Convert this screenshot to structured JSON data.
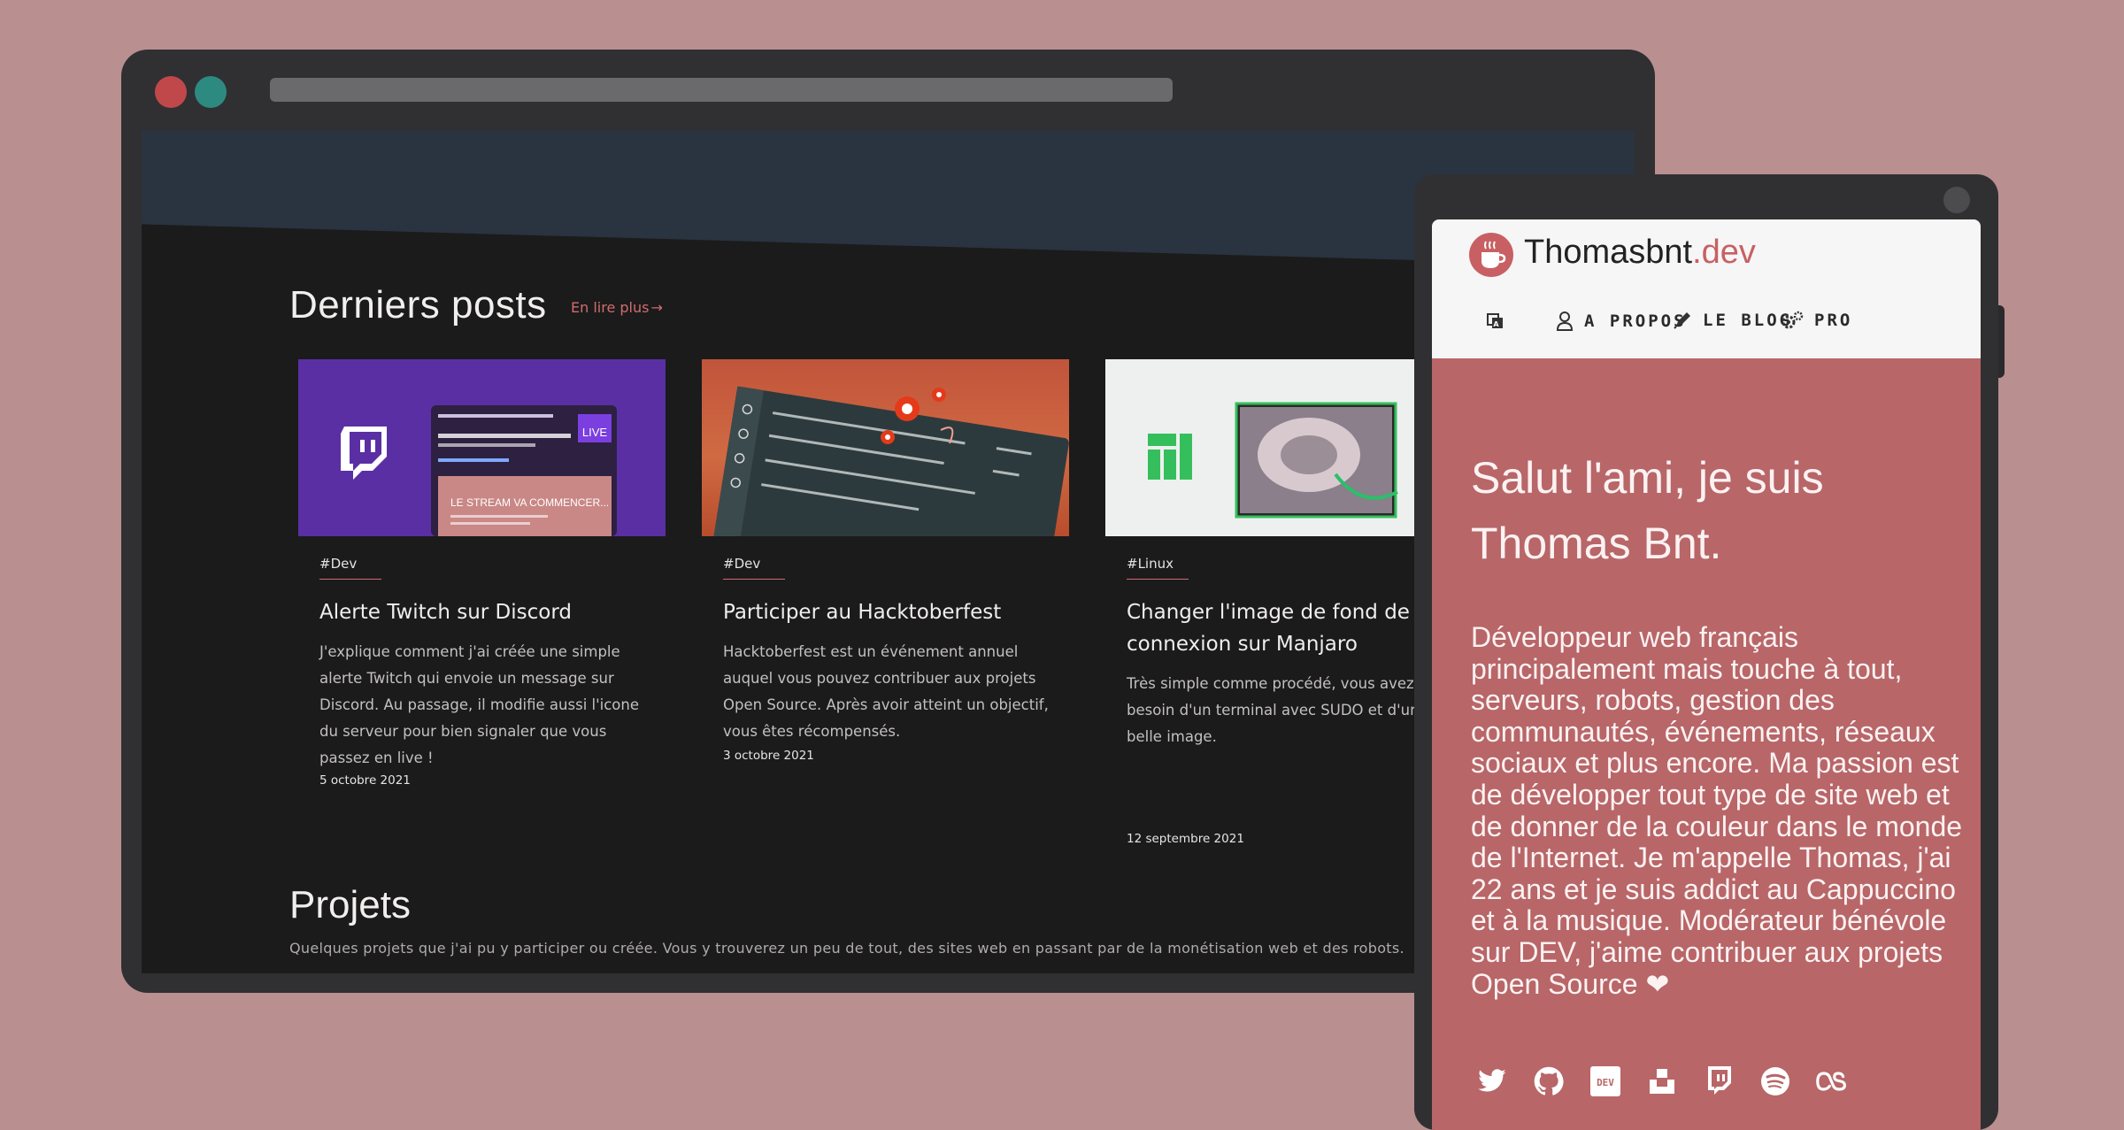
{
  "desktop": {
    "posts_section": {
      "title": "Derniers posts",
      "read_more": "En lire plus",
      "cards": [
        {
          "tag": "#Dev",
          "title": "Alerte Twitch sur Discord",
          "description": "J'explique comment j'ai créée une simple alerte Twitch qui envoie un message sur Discord. Au passage, il modifie aussi l'icone du serveur pour bien signaler que vous passez en live !",
          "date": "5 octobre 2021",
          "thumb_live": "LIVE",
          "thumb_stream": "LE STREAM VA COMMENCER..."
        },
        {
          "tag": "#Dev",
          "title": "Participer au Hacktoberfest",
          "description": "Hacktoberfest est un événement annuel auquel vous pouvez contribuer aux projets Open Source. Après avoir atteint un objectif, vous êtes récompensés.",
          "date": "3 octobre 2021"
        },
        {
          "tag": "#Linux",
          "title": "Changer l'image de fond de connexion sur Manjaro",
          "description": "Très simple comme procédé, vous avez besoin d'un terminal avec SUDO et d'une belle image.",
          "date": "12 septembre 2021"
        }
      ]
    },
    "projects_section": {
      "title": "Projets",
      "description": "Quelques projets que j'ai pu y participer ou créée. Vous y trouverez un peu de tout, des sites web en passant par de la monétisation web et des robots."
    }
  },
  "mobile": {
    "brand_main": "Thomasbnt",
    "brand_suffix": ".dev",
    "nav": [
      {
        "label": "A PROPOS",
        "icon": "user-icon"
      },
      {
        "label": "LE BLOG",
        "icon": "pencil-icon"
      },
      {
        "label": "PRO",
        "icon": "gears-icon"
      }
    ],
    "hello": "Salut l'ami, je suis Thomas Bnt.",
    "bio": "Développeur web français principalement mais touche à tout, serveurs, robots, gestion des communautés, événements, réseaux sociaux et plus encore. Ma passion est de développer tout type de site web et de donner de la couleur dans le monde de l'Internet. Je m'appelle Thomas, j'ai 22 ans et je suis addict au Cappuccino et à la musique. Modérateur bénévole sur DEV, j'aime contribuer aux projets Open Source ❤",
    "socials": [
      "twitter-icon",
      "github-icon",
      "dev-icon",
      "unsplash-icon",
      "twitch-icon",
      "spotify-icon",
      "lastfm-icon"
    ],
    "dev_badge": "DEV"
  },
  "colors": {
    "background": "#b98f90",
    "accent": "#d06c6e",
    "mobile_bg": "#b86668",
    "hero_band": "#2a3340"
  }
}
